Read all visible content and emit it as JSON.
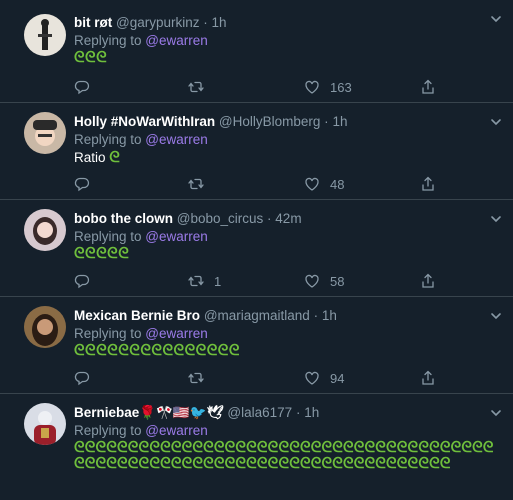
{
  "tweets": [
    {
      "name": "bit røt",
      "handle": "@garypurkinz",
      "time": "1h",
      "replying_prefix": "Replying to ",
      "mention": "@ewarren",
      "text": "",
      "emojis": "ᘓᘓᘓ",
      "retweets": "",
      "likes": "163"
    },
    {
      "name": "Holly #NoWarWithIran",
      "handle": "@HollyBlomberg",
      "time": "1h",
      "replying_prefix": "Replying to ",
      "mention": "@ewarren",
      "text": "Ratio",
      "emojis": "ᘓ",
      "retweets": "",
      "likes": "48"
    },
    {
      "name": "bobo the clown",
      "handle": "@bobo_circus",
      "time": "42m",
      "replying_prefix": "Replying to ",
      "mention": "@ewarren",
      "text": "",
      "emojis": "ᘓᘓᘓᘓᘓ",
      "retweets": "1",
      "likes": "58"
    },
    {
      "name": "Mexican Bernie Bro",
      "handle": "@mariagmaitland",
      "time": "1h",
      "replying_prefix": "Replying to ",
      "mention": "@ewarren",
      "text": "",
      "emojis": "ᘓᘓᘓᘓᘓᘓᘓᘓᘓᘓᘓᘓᘓᘓᘓ",
      "retweets": "",
      "likes": "94"
    },
    {
      "name": "Berniebae🌹🎌🇺🇸🐦🕊",
      "handle": "@lala6177",
      "time": "1h",
      "replying_prefix": "Replying to ",
      "mention": "@ewarren",
      "text": "",
      "emojis": "ᘓᘓᘓᘓᘓᘓᘓᘓᘓᘓᘓᘓᘓᘓᘓᘓᘓᘓᘓᘓᘓᘓᘓᘓᘓᘓᘓᘓᘓᘓᘓᘓᘓᘓᘓᘓᘓᘓᘓᘓᘓᘓᘓᘓᘓᘓᘓᘓᘓᘓᘓᘓᘓᘓᘓᘓᘓᘓᘓᘓᘓᘓᘓᘓᘓᘓᘓᘓᘓᘓᘓᘓᘓᘓ",
      "retweets": "",
      "likes": ""
    }
  ],
  "icons": {
    "reply": "reply-icon",
    "retweet": "retweet-icon",
    "like": "heart-icon",
    "share": "share-icon",
    "more": "chevron-down-icon"
  },
  "colors": {
    "background": "#15202b",
    "divider": "#38444d",
    "muted": "#8899a6",
    "mention": "#9b7be8",
    "emoji": "#6fbf3c"
  }
}
